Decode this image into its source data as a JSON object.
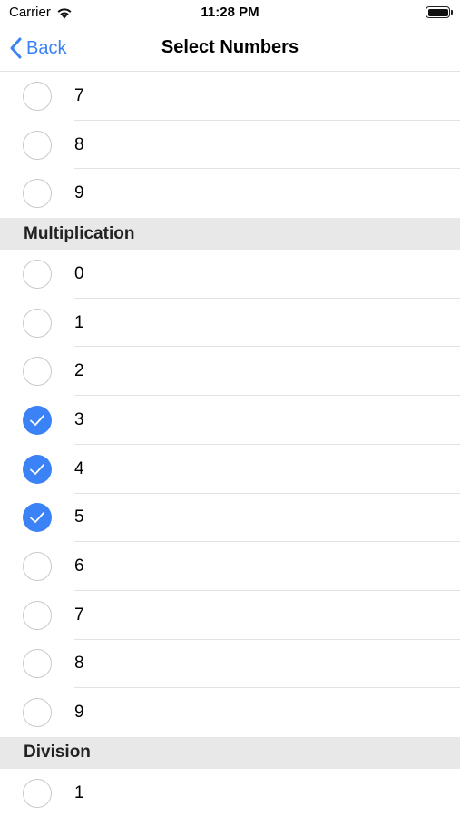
{
  "status_bar": {
    "carrier": "Carrier",
    "time": "11:28 PM"
  },
  "nav": {
    "back_label": "Back",
    "title": "Select Numbers"
  },
  "accent_color": "#3b82f6",
  "top_rows": [
    {
      "label": "7",
      "checked": false
    },
    {
      "label": "8",
      "checked": false
    },
    {
      "label": "9",
      "checked": false
    }
  ],
  "sections": [
    {
      "title": "Multiplication",
      "rows": [
        {
          "label": "0",
          "checked": false
        },
        {
          "label": "1",
          "checked": false
        },
        {
          "label": "2",
          "checked": false
        },
        {
          "label": "3",
          "checked": true
        },
        {
          "label": "4",
          "checked": true
        },
        {
          "label": "5",
          "checked": true
        },
        {
          "label": "6",
          "checked": false
        },
        {
          "label": "7",
          "checked": false
        },
        {
          "label": "8",
          "checked": false
        },
        {
          "label": "9",
          "checked": false
        }
      ]
    },
    {
      "title": "Division",
      "rows": [
        {
          "label": "1",
          "checked": false
        }
      ]
    }
  ]
}
